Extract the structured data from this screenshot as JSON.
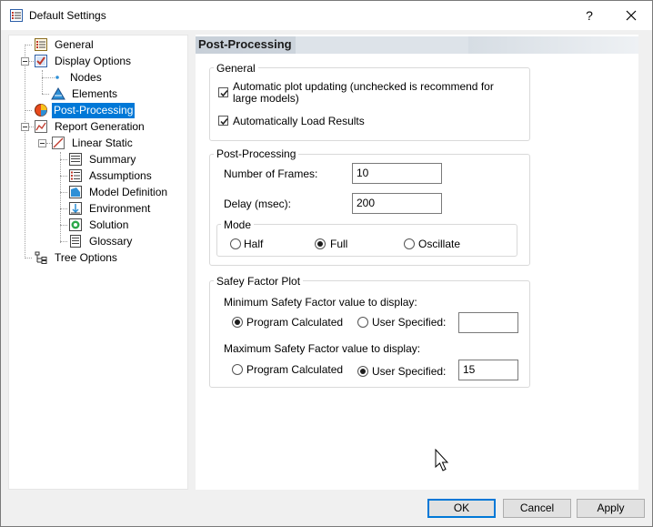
{
  "window": {
    "title": "Default Settings",
    "help": "?"
  },
  "tree": {
    "items": [
      {
        "label": "General"
      },
      {
        "label": "Display Options"
      },
      {
        "label": "Nodes"
      },
      {
        "label": "Elements"
      },
      {
        "label": "Post-Processing"
      },
      {
        "label": "Report Generation"
      },
      {
        "label": "Linear Static"
      },
      {
        "label": "Summary"
      },
      {
        "label": "Assumptions"
      },
      {
        "label": "Model Definition"
      },
      {
        "label": "Environment"
      },
      {
        "label": "Solution"
      },
      {
        "label": "Glossary"
      },
      {
        "label": "Tree Options"
      }
    ],
    "selected": "Post-Processing"
  },
  "page": {
    "title": "Post-Processing",
    "general": {
      "title": "General",
      "auto_update": {
        "label": "Automatic plot updating (unchecked is recommend for large models)",
        "checked": true
      },
      "auto_load": {
        "label": "Automatically Load Results",
        "checked": true
      }
    },
    "postproc": {
      "title": "Post-Processing",
      "frames_label": "Number of Frames:",
      "frames_value": "10",
      "delay_label": "Delay (msec):",
      "delay_value": "200",
      "mode": {
        "title": "Mode",
        "options": [
          "Half",
          "Full",
          "Oscillate"
        ],
        "selected": "Full"
      }
    },
    "safety": {
      "title": "Safey Factor Plot",
      "min_label": "Minimum Safety Factor value to display:",
      "min_options": [
        "Program Calculated",
        "User Specified:"
      ],
      "min_selected": "Program Calculated",
      "min_value": "",
      "max_label": "Maximum Safety Factor value to display:",
      "max_options": [
        "Program Calculated",
        "User Specified:"
      ],
      "max_selected": "User Specified:",
      "max_value": "15"
    }
  },
  "buttons": {
    "ok": "OK",
    "cancel": "Cancel",
    "apply": "Apply"
  },
  "colors": {
    "selection": "#0078d7",
    "default_button_border": "#0078d7"
  }
}
